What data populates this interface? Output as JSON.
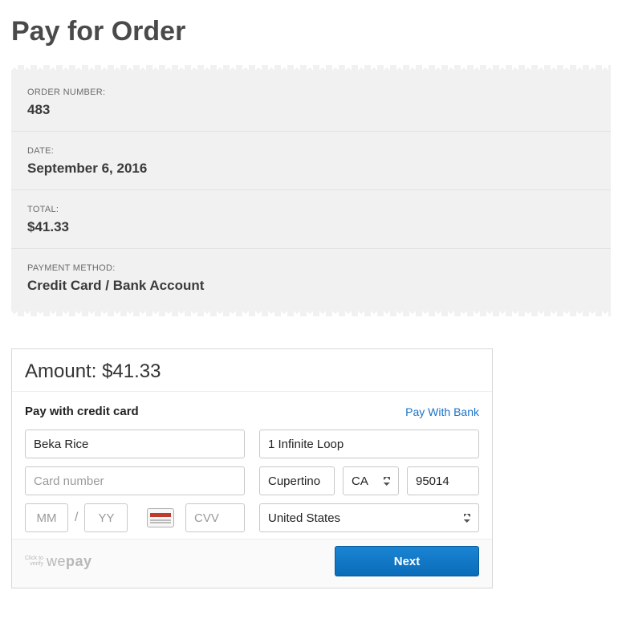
{
  "page_title": "Pay for Order",
  "receipt": {
    "order_number_label": "ORDER NUMBER:",
    "order_number": "483",
    "date_label": "DATE:",
    "date": "September 6, 2016",
    "total_label": "TOTAL:",
    "total": "$41.33",
    "pay_method_label": "PAYMENT METHOD:",
    "pay_method": "Credit Card / Bank Account"
  },
  "panel": {
    "amount_label": "Amount:",
    "amount_value": "$41.33",
    "pay_cc_title": "Pay with credit card",
    "pay_bank_link": "Pay With Bank",
    "name_value": "Beka Rice",
    "card_placeholder": "Card number",
    "mm_placeholder": "MM",
    "yy_placeholder": "YY",
    "cvv_placeholder": "CVV",
    "address_value": "1 Infinite Loop",
    "city_value": "Cupertino",
    "state_value": "CA",
    "zip_value": "95014",
    "country_value": "United States",
    "verify_prefix_line1": "Click to",
    "verify_prefix_line2": "verify",
    "brand_light": "we",
    "brand_bold": "pay",
    "next_label": "Next"
  }
}
